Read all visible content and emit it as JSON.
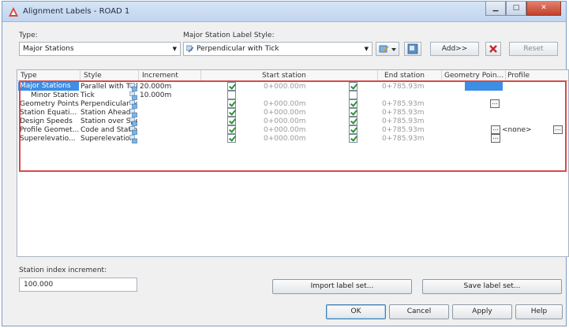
{
  "window": {
    "title": "Alignment Labels - ROAD 1"
  },
  "type_label": "Type:",
  "type_value": "Major Stations",
  "style_label": "Major Station Label Style:",
  "style_value": "Perpendicular with Tick",
  "add_button": "Add>>",
  "reset_button": "Reset",
  "columns": [
    "Type",
    "Style",
    "Increment",
    "Start station",
    "End station",
    "Geometry Poin...",
    "Profile"
  ],
  "rows": [
    {
      "type": "Major Stations",
      "style": "Parallel with Tick",
      "increment": "20.000m",
      "start_checked": true,
      "start": "0+000.00m",
      "end_checked": true,
      "end": "0+785.93m",
      "geometry": "",
      "profile": ""
    },
    {
      "type": "Minor Stations",
      "style": "Tick",
      "increment": "10.000m",
      "start_checked": false,
      "start": "",
      "end_checked": false,
      "end": "",
      "geometry": "",
      "profile": ""
    },
    {
      "type": "Geometry Points",
      "style": "Perpendicular with",
      "increment": "",
      "start_checked": true,
      "start": "0+000.00m",
      "end_checked": true,
      "end": "0+785.93m",
      "geometry": "...",
      "profile": ""
    },
    {
      "type": "Station Equati...",
      "style": "Station Ahead",
      "increment": "",
      "start_checked": true,
      "start": "0+000.00m",
      "end_checked": true,
      "end": "0+785.93m",
      "geometry": "",
      "profile": ""
    },
    {
      "type": "Design Speeds",
      "style": "Station over Speed",
      "increment": "",
      "start_checked": true,
      "start": "0+000.00m",
      "end_checked": true,
      "end": "0+785.93m",
      "geometry": "",
      "profile": ""
    },
    {
      "type": "Profile Geomet...",
      "style": "Code and Station",
      "increment": "",
      "start_checked": true,
      "start": "0+000.00m",
      "end_checked": true,
      "end": "0+785.93m",
      "geometry": "...",
      "profile": "<none>"
    },
    {
      "type": "Superelevatio...",
      "style": "Superelevation",
      "increment": "",
      "start_checked": true,
      "start": "0+000.00m",
      "end_checked": true,
      "end": "0+785.93m",
      "geometry": "...",
      "profile": ""
    }
  ],
  "station_index_label": "Station index increment:",
  "station_index_value": "100.000",
  "import_button": "Import label set...",
  "save_button": "Save label set...",
  "ok_button": "OK",
  "cancel_button": "Cancel",
  "apply_button": "Apply",
  "help_button": "Help",
  "colors": {
    "selection": "#3d8ee5",
    "highlight_frame": "#d84a4a",
    "check": "#2f8f3a"
  }
}
